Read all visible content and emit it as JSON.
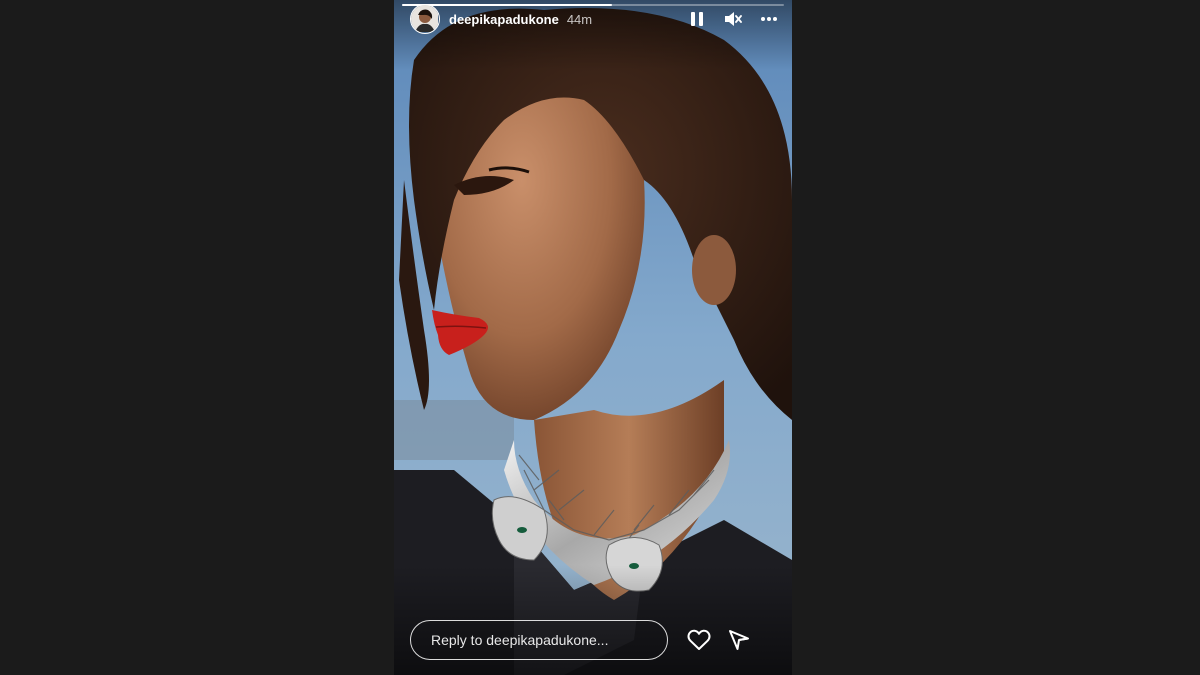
{
  "story": {
    "username": "deepikapadukone",
    "timestamp": "44m",
    "progress": 0.55,
    "reply_placeholder": "Reply to deepikapadukone..."
  },
  "icons": {
    "pause": "pause-icon",
    "mute": "speaker-muted-icon",
    "more": "more-horizontal-icon",
    "like": "heart-icon",
    "share": "send-icon"
  },
  "colors": {
    "background": "#1b1b1b",
    "lipstick": "#c8201c",
    "sky": "#4f7fb3"
  }
}
